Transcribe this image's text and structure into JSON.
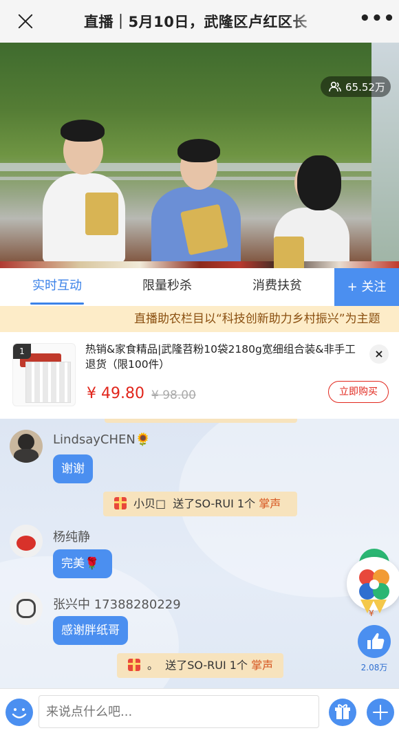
{
  "header": {
    "title": "直播｜5月10日，武隆区卢红区长",
    "more_label": "•••",
    "close_icon": "close-icon"
  },
  "video": {
    "viewers": "65.52万",
    "viewers_icon": "people-icon"
  },
  "tabs": [
    {
      "label": "实时互动",
      "active": true
    },
    {
      "label": "限量秒杀",
      "active": false
    },
    {
      "label": "消费扶贫",
      "active": false
    }
  ],
  "follow_label": "+ 关注",
  "banner": "直播助农栏目以“科技创新助力乡村振兴”为主题",
  "product": {
    "rank": "1",
    "title": "热销&家食精品|武隆苕粉10袋2180g宽细组合装&非手工退货（限100件）",
    "price": "¥ 49.80",
    "old_price": "¥ 98.00",
    "buy_label": "立即购买",
    "close_label": "×"
  },
  "chat": {
    "messages": [
      {
        "user": "LindsayCHEN",
        "user_badge": "🌻",
        "text": "谢谢"
      },
      {
        "user": "杨纯静",
        "text": "完美",
        "text_emoji": "🌹"
      },
      {
        "user": "张兴中 17388280229",
        "text": "感谢胖纸哥"
      }
    ],
    "gifts": [
      {
        "prefix": "小贝□",
        "action": "送了SO-RUI 1个",
        "item": "掌声"
      },
      {
        "prefix": "。",
        "action": "送了SO-RUI 1个",
        "item": "掌声"
      }
    ]
  },
  "side": {
    "likes": "2.08万"
  },
  "input": {
    "placeholder": "来说点什么吧..."
  },
  "colors": {
    "accent": "#4b8ff0",
    "price": "#e1251b",
    "banner_text": "#8a4f10",
    "gift_highlight": "#d6541e"
  }
}
